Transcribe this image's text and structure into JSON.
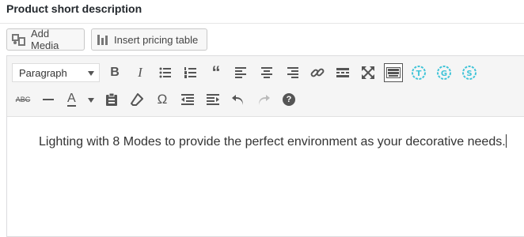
{
  "panel": {
    "title": "Product short description"
  },
  "media_buttons": {
    "add_media": "Add Media",
    "insert_pricing_table": "Insert pricing table"
  },
  "toolbar": {
    "format_select": "Paragraph",
    "bold": "B",
    "italic": "I",
    "strike": "ABC",
    "omega": "Ω",
    "help": "?",
    "text_color": "A"
  },
  "editor": {
    "content": "Lighting with 8 Modes to provide the perfect environment as your decorative needs."
  },
  "colors": {
    "accent": "#40c4d8",
    "border": "#dcdcde",
    "toolbar_bg": "#f5f5f5"
  }
}
